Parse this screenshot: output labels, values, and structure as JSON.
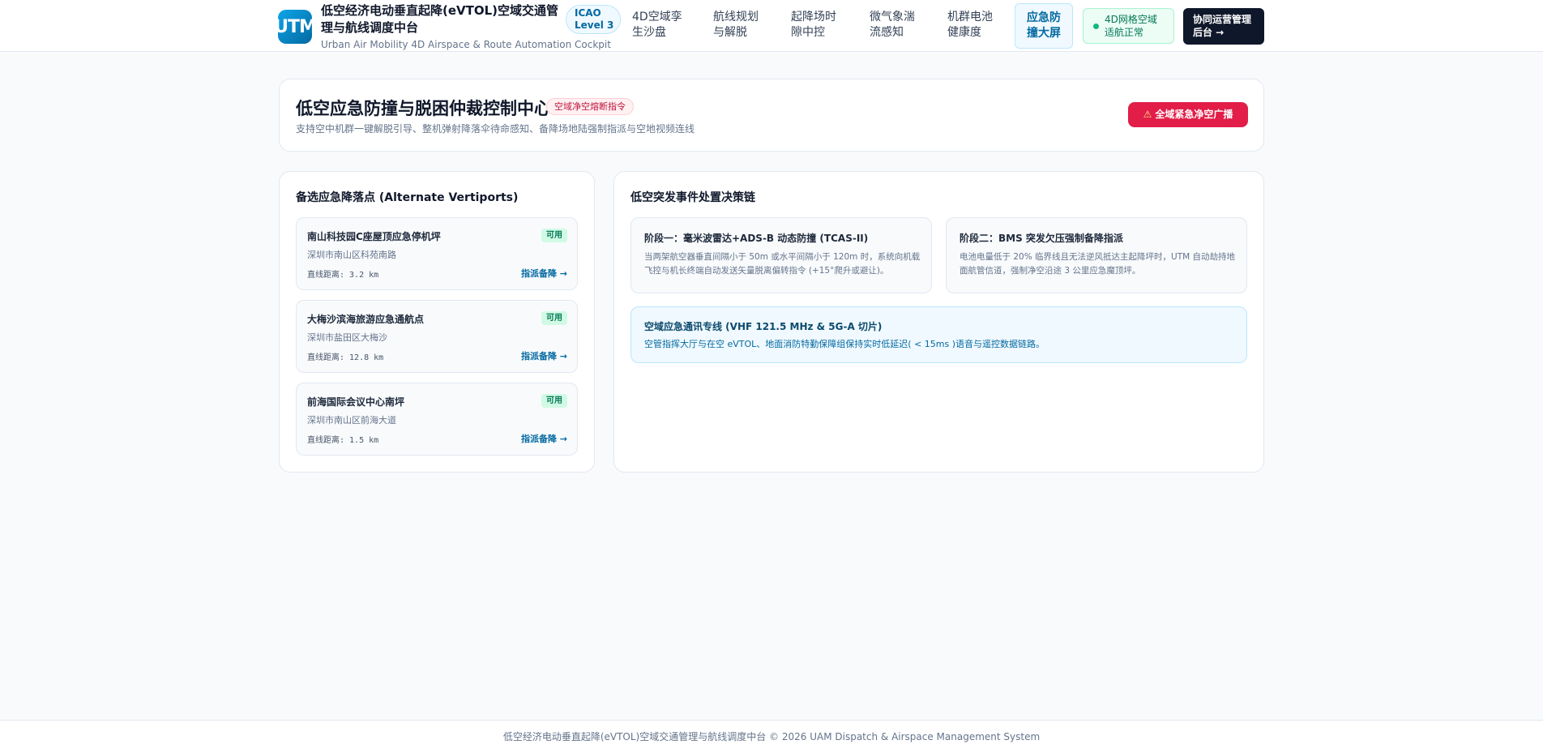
{
  "header": {
    "logo_text": "UTM",
    "title": "低空经济电动垂直起降(eVTOL)空域交通管理与航线调度中台",
    "subtitle": "Urban Air Mobility 4D Airspace & Route Automation Cockpit",
    "icao_badge": [
      "ICAO",
      "Level 3"
    ],
    "nav": [
      {
        "line1": "4D空域孪",
        "line2": "生沙盘"
      },
      {
        "line1": "航线规划",
        "line2": "与解脱"
      },
      {
        "line1": "起降场时",
        "line2": "隙中控"
      },
      {
        "line1": "微气象湍",
        "line2": "流感知"
      },
      {
        "line1": "机群电池",
        "line2": "健康度"
      },
      {
        "line1": "应急防",
        "line2": "撞大屏"
      }
    ],
    "status": [
      "4D网格空域",
      "适航正常"
    ],
    "admin_button": [
      "协同运营管理",
      "后台 →"
    ]
  },
  "hero": {
    "title": "低空应急防撞与脱困仲裁控制中心",
    "tag": "空域净空熔断指令",
    "description": "支持空中机群一键解脱引导、整机弹射降落伞待命感知、备降场地陆强制指派与空地视频连线",
    "emergency_button": "全域紧急净空广播"
  },
  "alternate_vertiports": {
    "title": "备选应急降落点 (Alternate Vertiports)",
    "items": [
      {
        "name": "南山科技园C座屋顶应急停机坪",
        "status": "可用",
        "address": "深圳市南山区科苑南路",
        "distance": "直线距离: 3.2 km",
        "action": "指派备降 →"
      },
      {
        "name": "大梅沙滨海旅游应急通航点",
        "status": "可用",
        "address": "深圳市盐田区大梅沙",
        "distance": "直线距离: 12.8 km",
        "action": "指派备降 →"
      },
      {
        "name": "前海国际会议中心南坪",
        "status": "可用",
        "address": "深圳市南山区前海大道",
        "distance": "直线距离: 1.5 km",
        "action": "指派备降 →"
      }
    ]
  },
  "decision_chain": {
    "title": "低空突发事件处置决策链",
    "stage1": {
      "title": "阶段一：毫米波雷达+ADS-B 动态防撞 (TCAS-II)",
      "description": "当两架航空器垂直间隔小于 50m 或水平间隔小于 120m 时，系统向机载飞控与机长终端自动发送矢量脱离偏转指令 (+15°爬升或避让)。"
    },
    "stage2": {
      "title": "阶段二：BMS 突发欠压强制备降指派",
      "description": "电池电量低于 20% 临界线且无法逆风抵达主起降坪时，UTM 自动劫持地面航管信道，强制净空沿途 3 公里应急魔顶坪。"
    },
    "comm": {
      "title": "空域应急通讯专线 (VHF 121.5 MHz & 5G-A 切片)",
      "description": "空管指挥大厅与在空 eVTOL、地面消防特勤保障组保持实时低延迟( < 15ms )语音与遥控数据链路。"
    }
  },
  "footer": {
    "text": "低空经济电动垂直起降(eVTOL)空域交通管理与航线调度中台 © 2026 UAM Dispatch & Airspace Management System"
  },
  "colors": {
    "accent": "#0369a1",
    "danger": "#e11d48",
    "success": "#047857",
    "dark": "#0f172a"
  }
}
